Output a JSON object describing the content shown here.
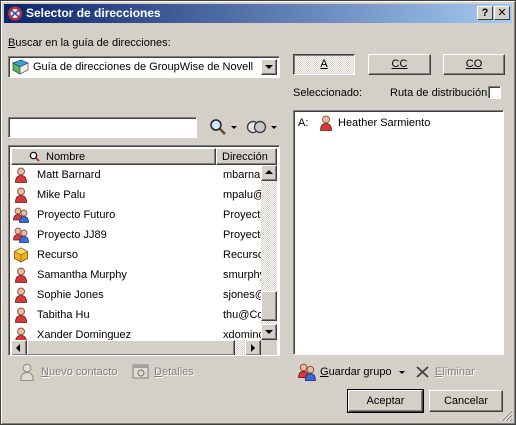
{
  "window": {
    "title": "Selector de direcciones",
    "help_label": "?",
    "close_label": "✕"
  },
  "search_label": "Buscar en la guía de direcciones:",
  "address_book": {
    "selected": "Guía de direcciones de GroupWise de Novell"
  },
  "search": {
    "value": "",
    "placeholder": ""
  },
  "columns": {
    "name": "Nombre",
    "address": "Dirección"
  },
  "contacts": [
    {
      "name": "Matt Barnard",
      "address": "mbarnard",
      "icon": "user-icon"
    },
    {
      "name": "Mike Palu",
      "address": "mpalu@",
      "icon": "user-icon"
    },
    {
      "name": "Proyecto Futuro",
      "address": "Proyecto",
      "icon": "group-icon"
    },
    {
      "name": "Proyecto JJ89",
      "address": "Proyecto",
      "icon": "group-icon"
    },
    {
      "name": "Recurso",
      "address": "Recurso",
      "icon": "resource-icon"
    },
    {
      "name": "Samantha Murphy",
      "address": "smurphy",
      "icon": "user-icon"
    },
    {
      "name": "Sophie Jones",
      "address": "sjones@",
      "icon": "user-icon"
    },
    {
      "name": "Tabitha Hu",
      "address": "thu@Co",
      "icon": "user-icon"
    },
    {
      "name": "Xander Dominguez",
      "address": "xdominc",
      "icon": "user-icon"
    }
  ],
  "recipient_buttons": {
    "to": "A",
    "cc": "CC",
    "bcc": "CO"
  },
  "selected_label": "Seleccionado:",
  "distribution_route_label": "Ruta de distribución",
  "selected_recipients": [
    {
      "type": "A:",
      "name": "Heather Sarmiento",
      "icon": "user-icon"
    }
  ],
  "actions": {
    "new_contact": "Nuevo contacto",
    "details": "Detalles",
    "save_group": "Guardar grupo",
    "remove": "Eliminar",
    "ok": "Aceptar",
    "cancel": "Cancelar"
  },
  "colors": {
    "face": "#d4d0c8",
    "title_start": "#0a246a",
    "title_end": "#a6caf0",
    "person_head": "#f0b8a0",
    "person_body": "#d83838"
  }
}
